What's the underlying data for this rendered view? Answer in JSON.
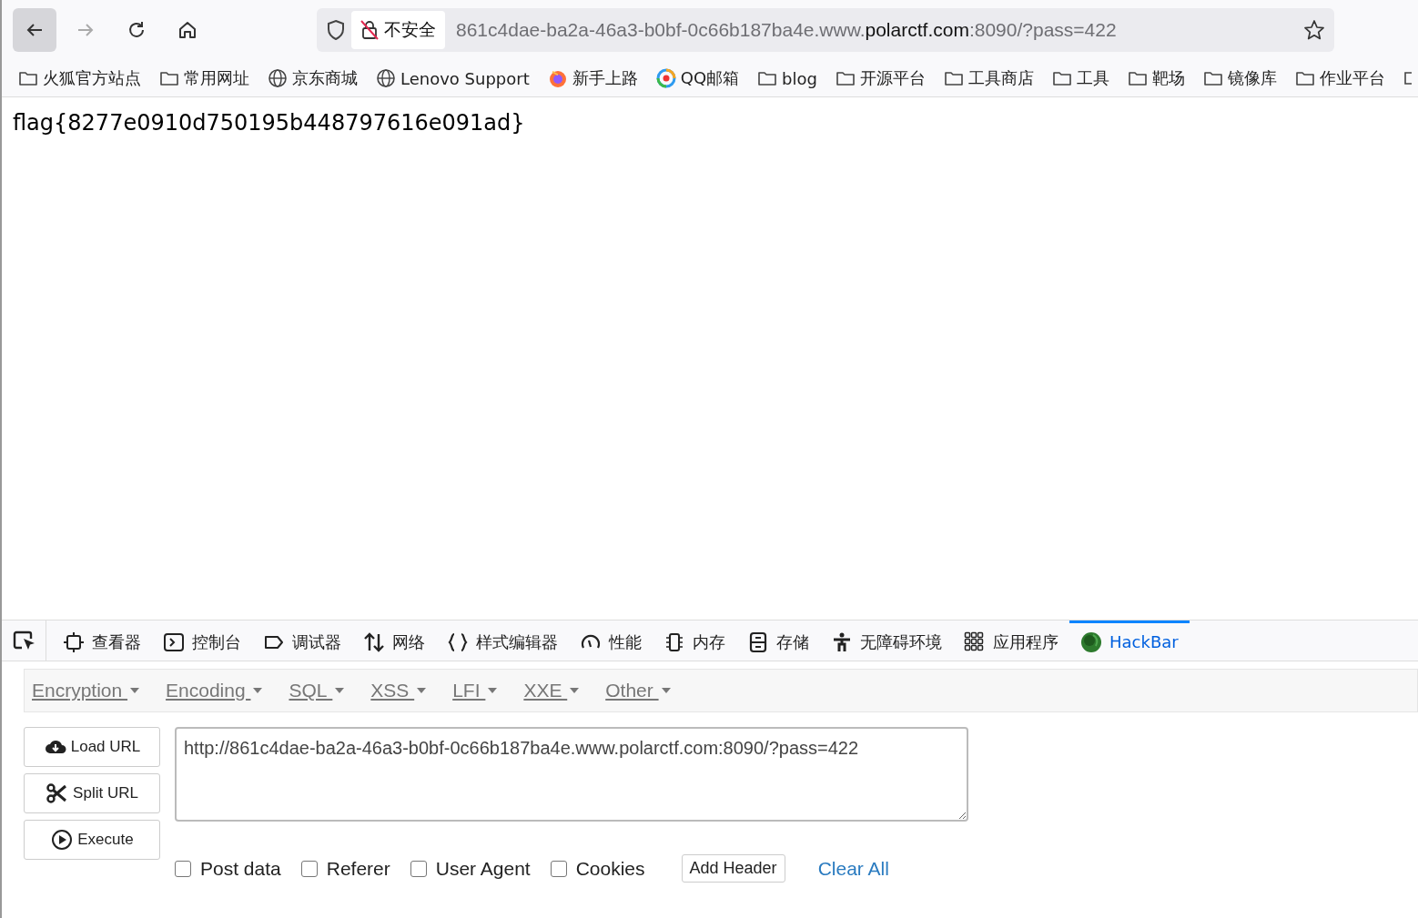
{
  "toolbar": {
    "security_label": "不安全",
    "url": {
      "prefix": "861c4dae-ba2a-46a3-b0bf-0c66b187ba4e.www.",
      "domain": "polarctf.com",
      "suffix": ":8090/?pass=422"
    }
  },
  "bookmarks": [
    {
      "kind": "folder",
      "label": "火狐官方站点"
    },
    {
      "kind": "folder",
      "label": "常用网址"
    },
    {
      "kind": "globe",
      "label": "京东商城"
    },
    {
      "kind": "globe",
      "label": "Lenovo Support"
    },
    {
      "kind": "firefox",
      "label": "新手上路"
    },
    {
      "kind": "qq",
      "label": "QQ邮箱"
    },
    {
      "kind": "folder",
      "label": "blog"
    },
    {
      "kind": "folder",
      "label": "开源平台"
    },
    {
      "kind": "folder",
      "label": "工具商店"
    },
    {
      "kind": "folder",
      "label": "工具"
    },
    {
      "kind": "folder",
      "label": "靶场"
    },
    {
      "kind": "folder",
      "label": "镜像库"
    },
    {
      "kind": "folder",
      "label": "作业平台"
    }
  ],
  "page": {
    "text": "flag{8277e0910d750195b448797616e091ad}"
  },
  "devtools_tabs": [
    {
      "kind": "inspector",
      "label": "查看器",
      "selected": false
    },
    {
      "kind": "console",
      "label": "控制台",
      "selected": false
    },
    {
      "kind": "debugger",
      "label": "调试器",
      "selected": false
    },
    {
      "kind": "network",
      "label": "网络",
      "selected": false
    },
    {
      "kind": "style",
      "label": "样式编辑器",
      "selected": false
    },
    {
      "kind": "performance",
      "label": "性能",
      "selected": false
    },
    {
      "kind": "memory",
      "label": "内存",
      "selected": false
    },
    {
      "kind": "storage",
      "label": "存储",
      "selected": false
    },
    {
      "kind": "accessibility",
      "label": "无障碍环境",
      "selected": false
    },
    {
      "kind": "apps",
      "label": "应用程序",
      "selected": false
    },
    {
      "kind": "hackbar",
      "label": "HackBar",
      "selected": true
    }
  ],
  "hackbar": {
    "menus": [
      "Encryption",
      "Encoding",
      "SQL",
      "XSS",
      "LFI",
      "XXE",
      "Other"
    ],
    "buttons": [
      {
        "kind": "load",
        "label": "Load URL"
      },
      {
        "kind": "split",
        "label": "Split URL"
      },
      {
        "kind": "execute",
        "label": "Execute"
      }
    ],
    "url_value": "http://861c4dae-ba2a-46a3-b0bf-0c66b187ba4e.www.polarctf.com:8090/?pass=422",
    "options": [
      {
        "label": "Post data",
        "checked": false
      },
      {
        "label": "Referer",
        "checked": false
      },
      {
        "label": "User Agent",
        "checked": false
      },
      {
        "label": "Cookies",
        "checked": false
      }
    ],
    "add_header": "Add Header",
    "clear_all": "Clear All"
  }
}
